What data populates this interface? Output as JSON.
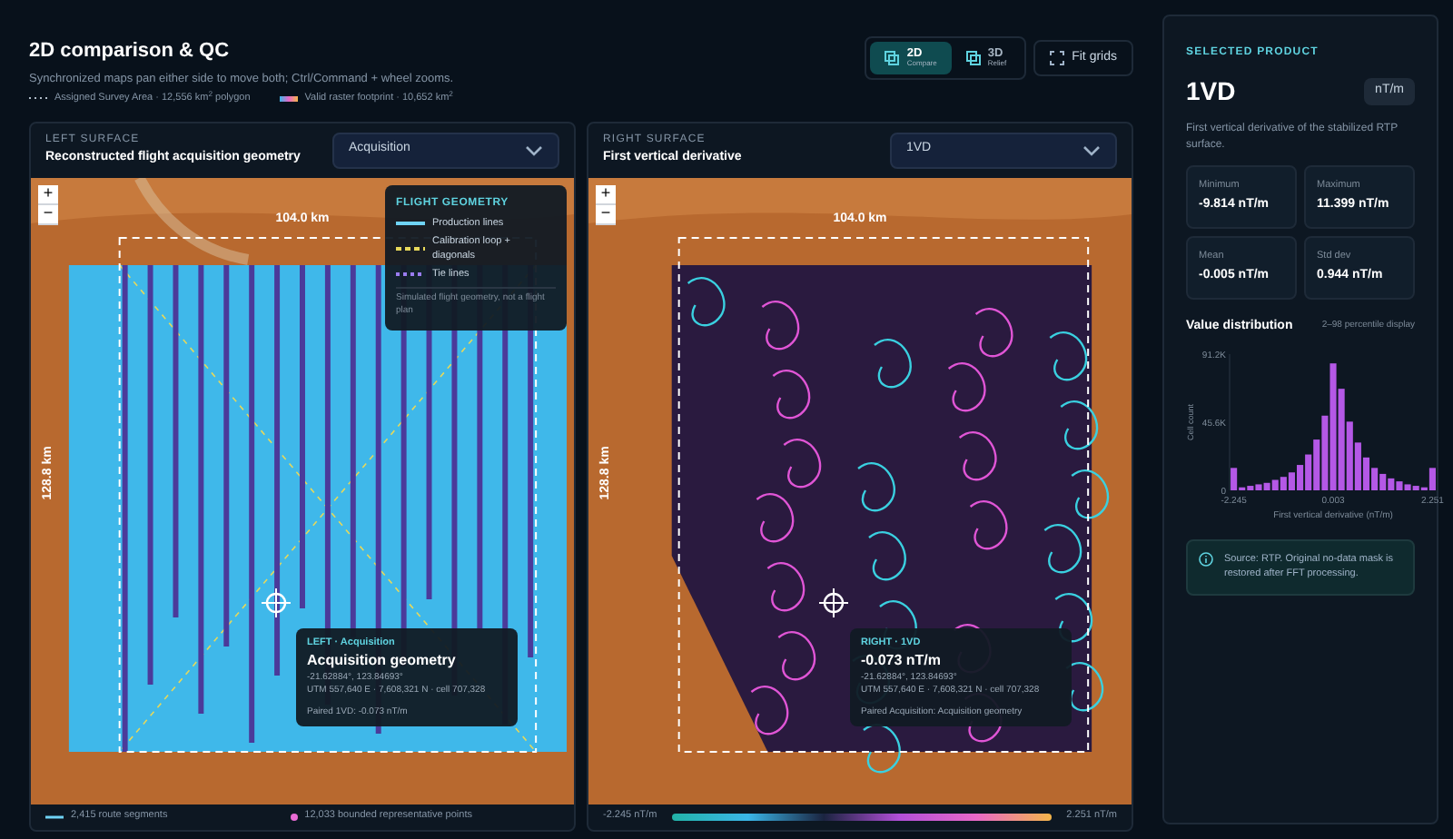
{
  "header": {
    "title": "2D comparison & QC",
    "subtitle": "Synchronized maps pan either side to move both; Ctrl/Command + wheel zooms.",
    "legend": [
      {
        "kind": "dotted",
        "label": "Assigned Survey Area · 12,556 km$^{2}$ polygon"
      },
      {
        "kind": "gradient",
        "label": "Valid raster footprint · 10,652 km$^{2}$"
      }
    ]
  },
  "view_modes": [
    {
      "label": "2D",
      "sub": "Compare",
      "selected": true
    },
    {
      "label": "3D",
      "sub": "Relief",
      "selected": false
    }
  ],
  "fit_button": "Fit grids",
  "panels": [
    {
      "kind": "acquisition",
      "zoom_controls": [
        "+",
        "−"
      ],
      "eyebrow": "LEFT SURFACE",
      "title": "Reconstructed flight acquisition geometry",
      "select": "Acquisition",
      "width_label": "104.0 km",
      "height_label": "128.8 km",
      "legend": {
        "title": "FLIGHT GEOMETRY",
        "items": [
          {
            "kind": "solid",
            "label": "Production lines"
          },
          {
            "kind": "dashed",
            "label": "Calibration loop + diagonals"
          },
          {
            "kind": "dotted",
            "label": "Tie lines"
          }
        ],
        "note": "Simulated flight geometry, not a flight plan"
      },
      "tooltip": {
        "tag": "LEFT · Acquisition",
        "title": "Acquisition geometry",
        "coords": "-21.62884°, 123.84693°",
        "utm": "UTM 557,640 E · 7,608,321 N · cell 707,328",
        "paired": "Paired 1VD: -0.073 nT/m"
      },
      "footer": {
        "kind": "counts",
        "items": [
          {
            "kind": "line",
            "label": "2,415 route segments"
          },
          {
            "kind": "dot",
            "label": "12,033 bounded representative points"
          }
        ]
      }
    },
    {
      "kind": "derivative",
      "zoom_controls": [
        "+",
        "−"
      ],
      "eyebrow": "RIGHT SURFACE",
      "title": "First vertical derivative",
      "select": "1VD",
      "width_label": "104.0 km",
      "height_label": "128.8 km",
      "tooltip": {
        "tag": "RIGHT · 1VD",
        "title": "-0.073 nT/m",
        "coords": "-21.62884°, 123.84693°",
        "utm": "UTM 557,640 E · 7,608,321 N · cell 707,328",
        "paired": "Paired Acquisition: Acquisition geometry"
      },
      "footer": {
        "kind": "scale",
        "min": "-2.245 nT/m",
        "max": "2.251 nT/m"
      }
    }
  ],
  "sidebar": {
    "eyebrow": "SELECTED PRODUCT",
    "product": "1VD",
    "unit": "nT/m",
    "description": "First vertical derivative of the stabilized RTP surface.",
    "stats": [
      {
        "label": "Minimum",
        "value": "-9.814 nT/m"
      },
      {
        "label": "Maximum",
        "value": "11.399 nT/m"
      },
      {
        "label": "Mean",
        "value": "-0.005 nT/m"
      },
      {
        "label": "Std dev",
        "value": "0.944 nT/m"
      }
    ],
    "distribution_title": "Value distribution",
    "distribution_note": "2–98 percentile display",
    "chart_data": {
      "type": "bar",
      "xlabel": "First vertical derivative (nT/m)",
      "ylabel": "Cell count",
      "x": [
        -2.245,
        -2.058,
        -1.87,
        -1.683,
        -1.496,
        -1.308,
        -1.121,
        -0.934,
        -0.746,
        -0.559,
        -0.372,
        -0.184,
        0.003,
        0.19,
        0.378,
        0.565,
        0.752,
        0.94,
        1.127,
        1.314,
        1.502,
        1.689,
        1.876,
        2.064,
        2.251
      ],
      "series": [
        {
          "color": "#b458e6",
          "values": [
            15000,
            2000,
            3000,
            4000,
            5000,
            7000,
            9000,
            12000,
            17000,
            24000,
            34000,
            50000,
            85000,
            68000,
            46000,
            32000,
            22000,
            15000,
            11000,
            8000,
            6000,
            4000,
            3000,
            2000,
            15000
          ]
        }
      ],
      "xlim": [
        -2.34,
        2.345
      ],
      "ylim": [
        0,
        91200
      ],
      "yticks": [
        {
          "value": 0,
          "label": "0"
        },
        {
          "value": 45600,
          "label": "45.6K"
        },
        {
          "value": 91200,
          "label": "91.2K"
        }
      ],
      "xticks": [
        {
          "value": -2.245,
          "label": "-2.245"
        },
        {
          "value": 0.003,
          "label": "0.003"
        },
        {
          "value": 2.251,
          "label": "2.251"
        }
      ]
    },
    "info": "Source: RTP. Original no-data mask is restored after FFT processing."
  }
}
